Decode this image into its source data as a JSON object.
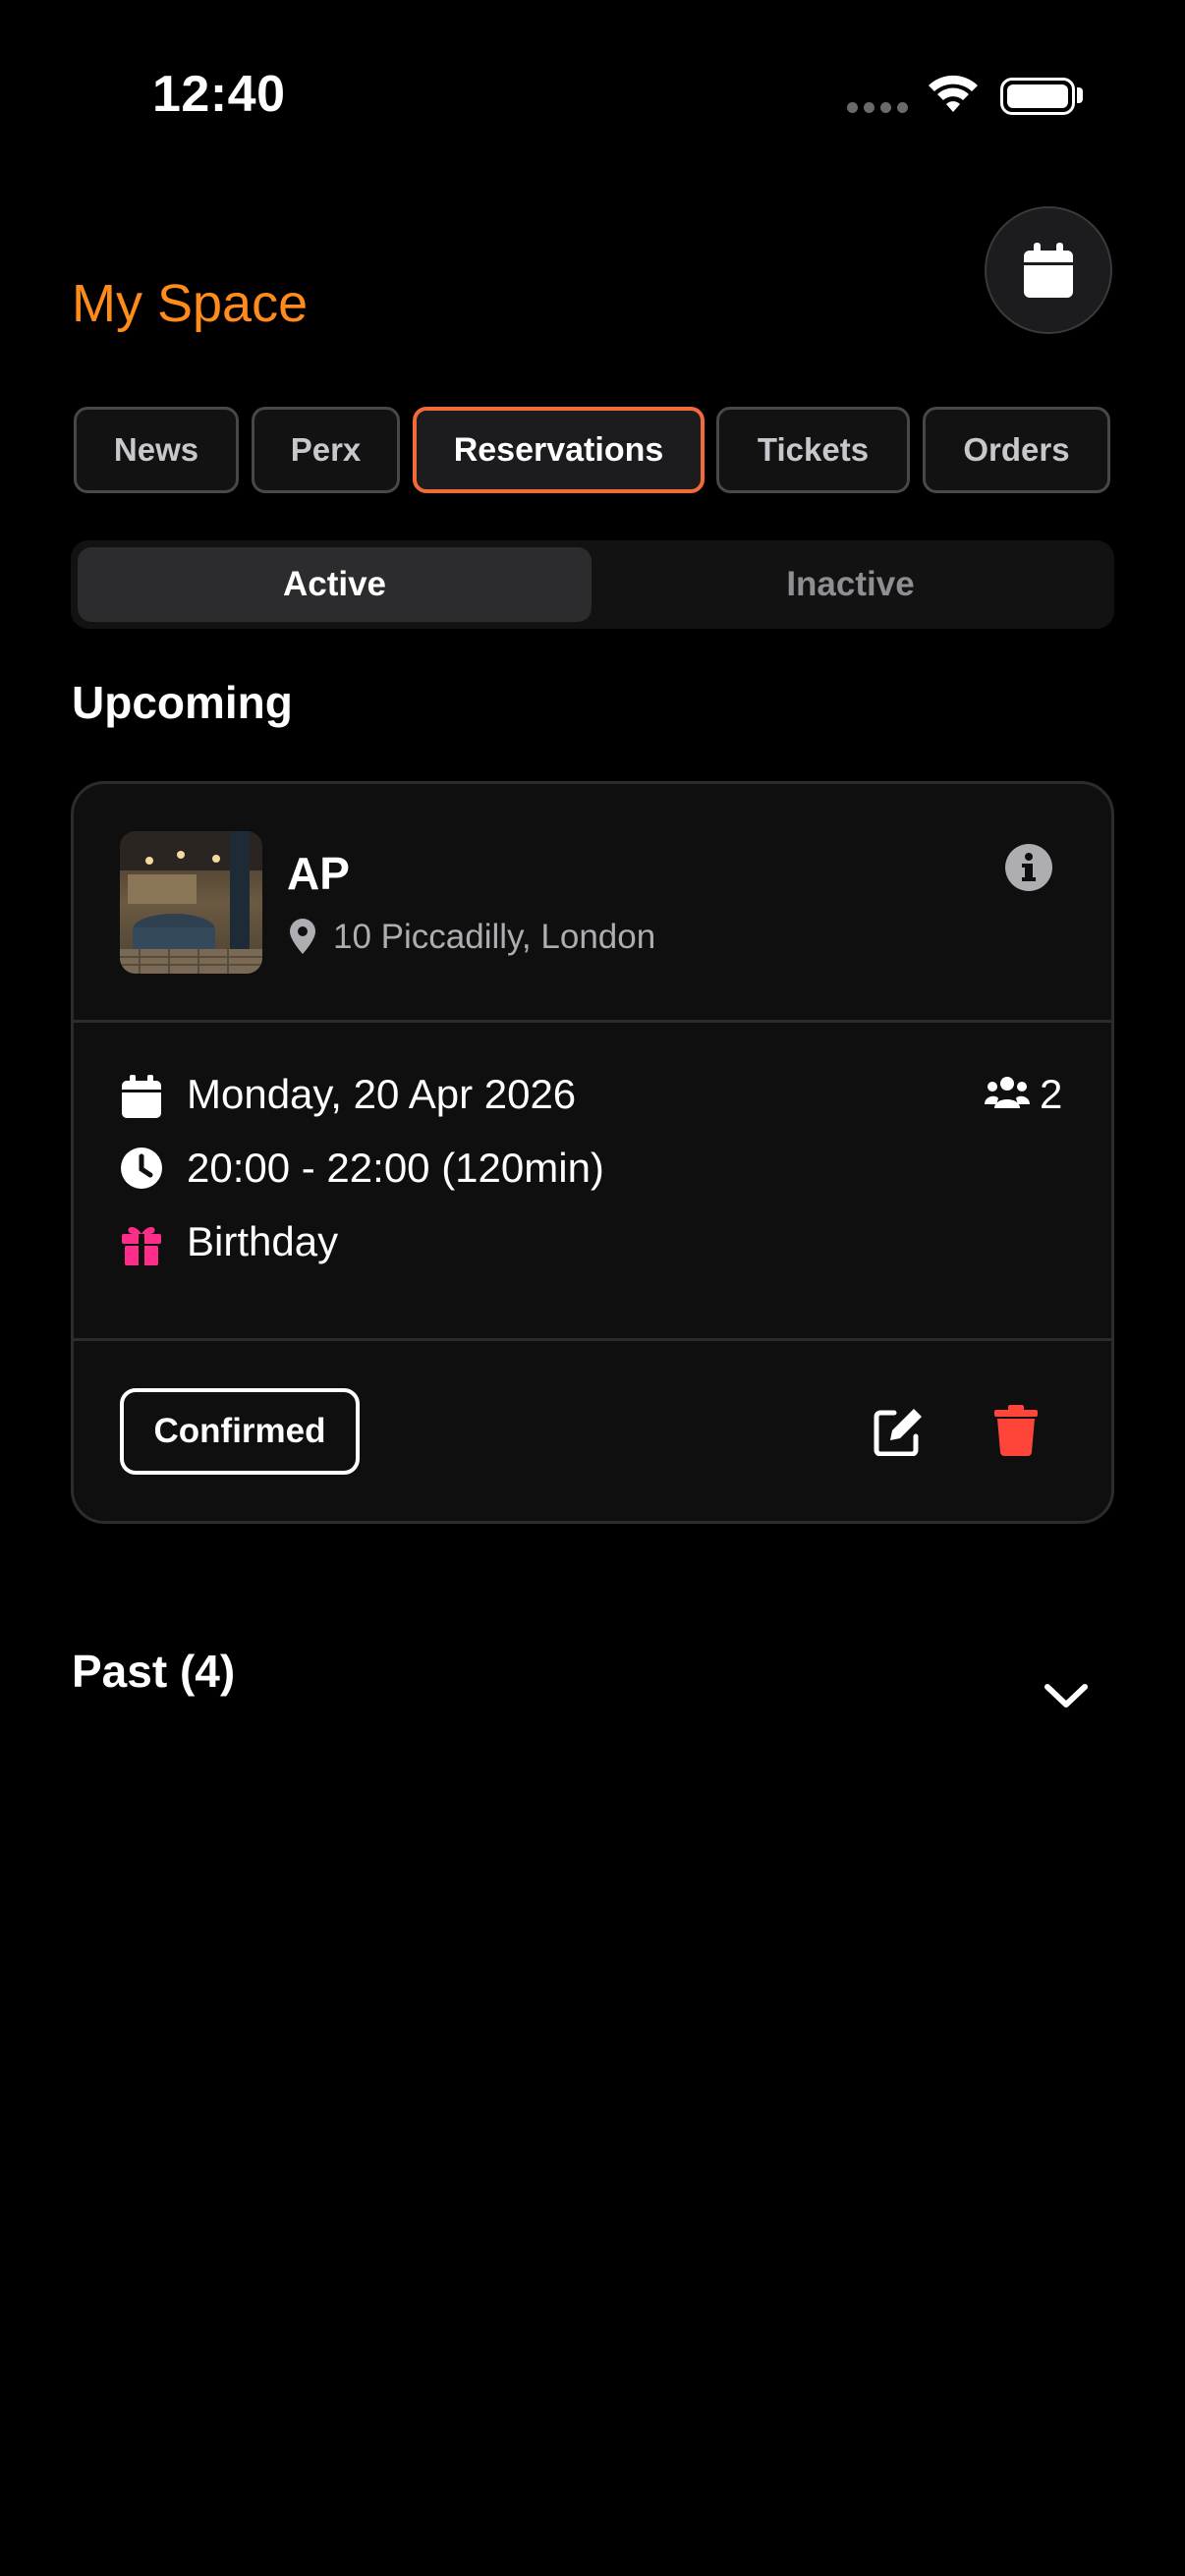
{
  "status_bar": {
    "time": "12:40"
  },
  "header": {
    "title": "My Space",
    "title_color": "#ff8c1a",
    "calendar_button_icon": "calendar-icon"
  },
  "tabs": [
    {
      "label": "News",
      "active": false
    },
    {
      "label": "Perx",
      "active": false
    },
    {
      "label": "Reservations",
      "active": true
    },
    {
      "label": "Tickets",
      "active": false
    },
    {
      "label": "Orders",
      "active": false
    }
  ],
  "segment": {
    "options": [
      "Active",
      "Inactive"
    ],
    "selected": "Active"
  },
  "upcoming": {
    "heading": "Upcoming",
    "reservation": {
      "venue_name": "AP",
      "address": "10 Piccadilly, London",
      "date": "Monday, 20 Apr 2026",
      "time": "20:00 - 22:00 (120min)",
      "occasion": "Birthday",
      "guests": "2",
      "status": "Confirmed",
      "colors": {
        "occasion_icon": "#ff2d8a",
        "delete_icon": "#ff453a"
      }
    }
  },
  "past": {
    "heading": "Past (4)"
  }
}
